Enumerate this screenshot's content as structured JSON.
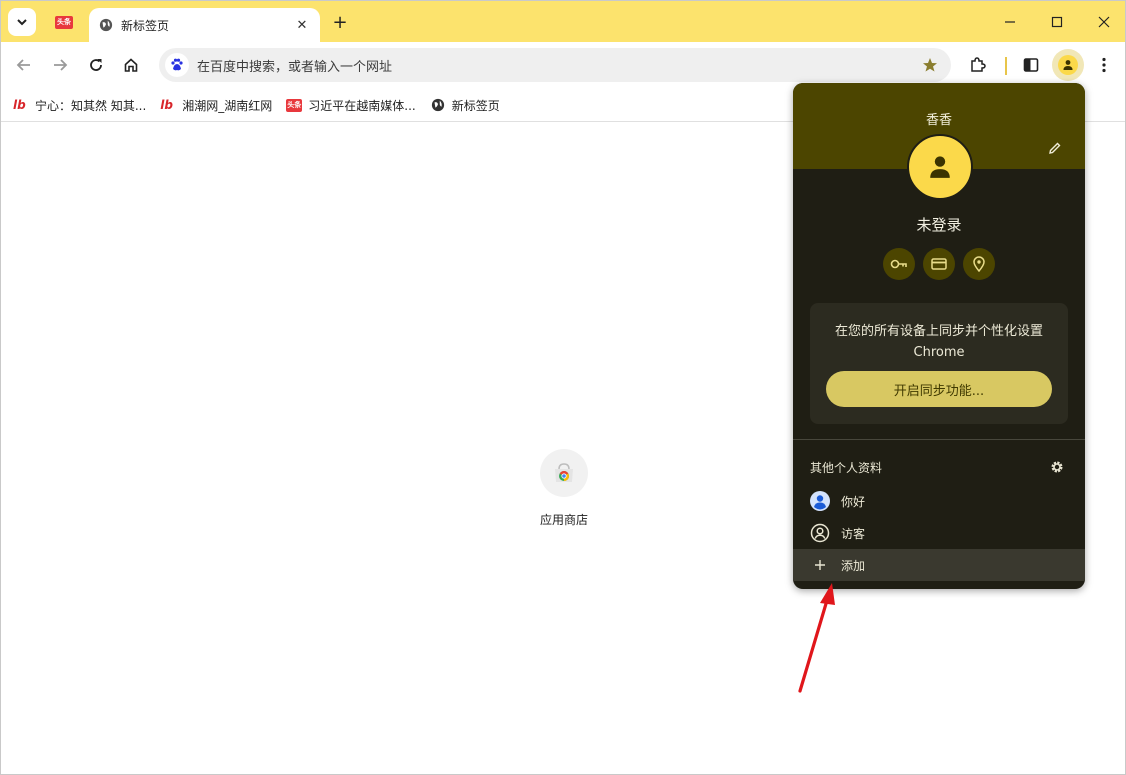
{
  "browser": {
    "active_tab_title": "新标签页",
    "pinned_tab_icon": "头条",
    "close_symbol": "✕",
    "new_tab_symbol": "+"
  },
  "omnibox": {
    "placeholder": "在百度中搜索，或者输入一个网址"
  },
  "bookmarks": [
    {
      "label": "宁心：知其然 知其...",
      "icon": "red-logo-icon"
    },
    {
      "label": "湘潮网_湖南红网",
      "icon": "red-logo-icon"
    },
    {
      "label": "习近平在越南媒体...",
      "icon": "toutiao-icon",
      "icon_text": "头条"
    },
    {
      "label": "新标签页",
      "icon": "globe-icon"
    }
  ],
  "shortcut": {
    "label": "应用商店"
  },
  "profile_menu": {
    "profile_name": "香香",
    "status": "未登录",
    "sync_message_line1": "在您的所有设备上同步并个性化设置",
    "sync_message_line2": "Chrome",
    "sync_button": "开启同步功能...",
    "other_profiles_title": "其他个人资料",
    "profiles": [
      {
        "label": "你好"
      },
      {
        "label": "访客"
      }
    ],
    "add_label": "添加"
  },
  "colors": {
    "tabstrip": "#fce36d",
    "menu_bg": "#1f1e14",
    "menu_header": "#4c4500",
    "avatar": "#fbd94a",
    "sync_button": "#d8c862",
    "arrow": "#e0161b"
  }
}
